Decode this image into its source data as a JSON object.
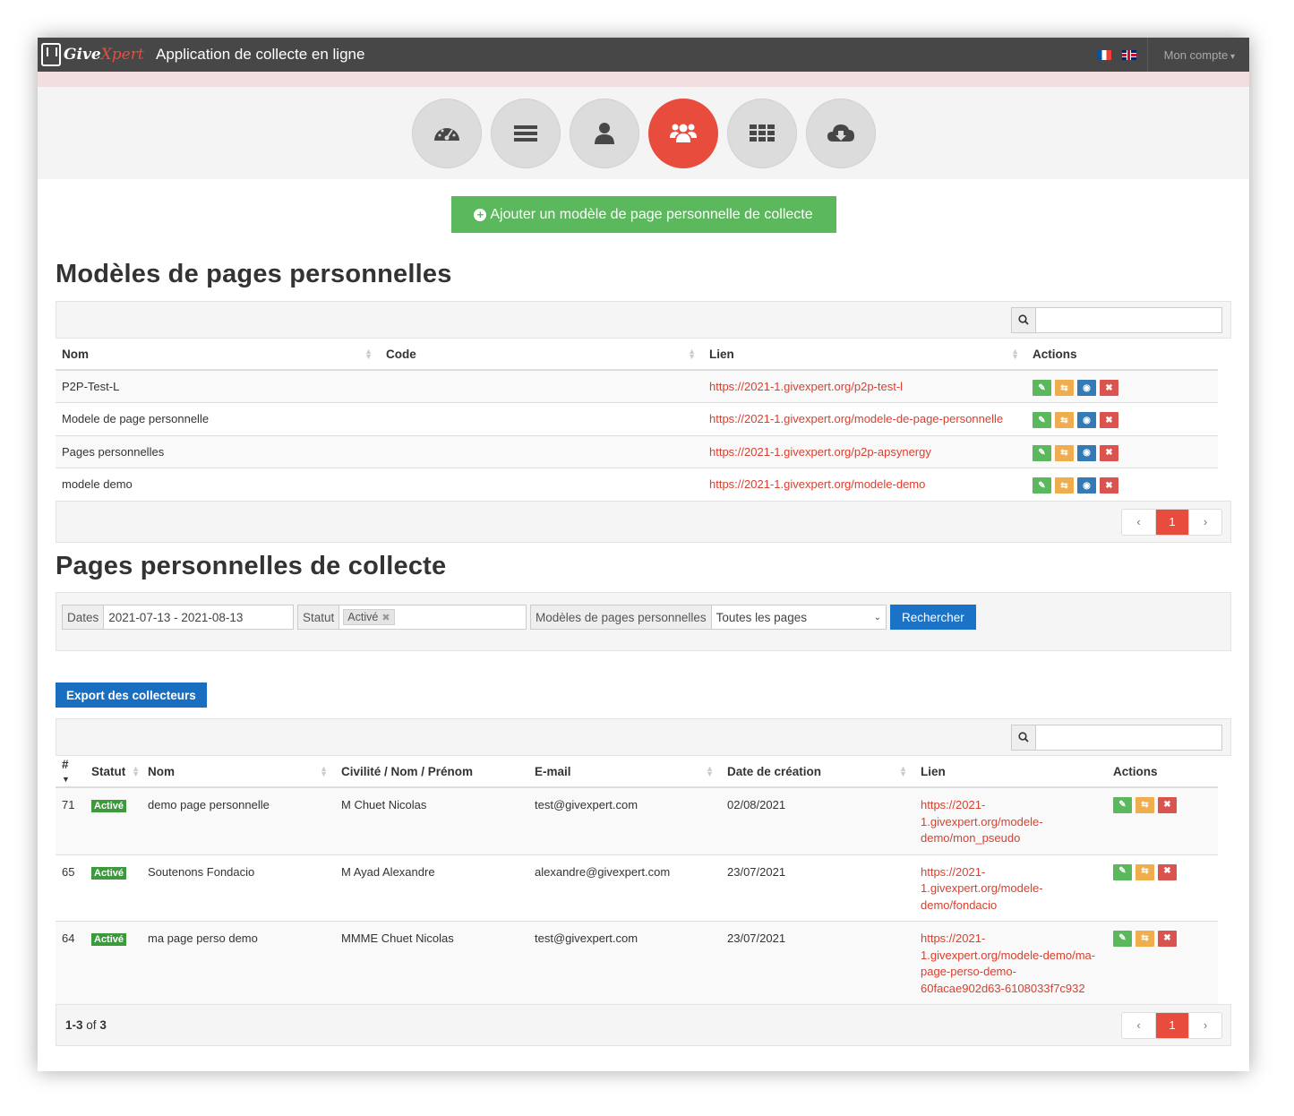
{
  "header": {
    "logo_give": "Give",
    "logo_xpert": "Xpert",
    "title": "Application de collecte en ligne",
    "account": "Mon compte"
  },
  "nav_icons": [
    "dashboard-icon",
    "list-icon",
    "user-icon",
    "group-icon",
    "grid-icon",
    "cloud-download-icon"
  ],
  "add_button": "Ajouter un modèle de page personnelle de collecte",
  "models": {
    "title": "Modèles de pages personnelles",
    "columns": [
      "Nom",
      "Code",
      "Lien",
      "Actions"
    ],
    "rows": [
      {
        "nom": "P2P-Test-L",
        "code": "",
        "lien": "https://2021-1.givexpert.org/p2p-test-l"
      },
      {
        "nom": "Modele de page personnelle",
        "code": "",
        "lien": "https://2021-1.givexpert.org/modele-de-page-personnelle"
      },
      {
        "nom": "Pages personnelles",
        "code": "",
        "lien": "https://2021-1.givexpert.org/p2p-apsynergy"
      },
      {
        "nom": "modele demo",
        "code": "",
        "lien": "https://2021-1.givexpert.org/modele-demo"
      }
    ],
    "pager": {
      "prev": "‹",
      "page": "1",
      "next": "›"
    }
  },
  "pages": {
    "title": "Pages personnelles de collecte",
    "filters": {
      "dates_label": "Dates",
      "dates_value": "2021-07-13 - 2021-08-13",
      "statut_label": "Statut",
      "statut_tag": "Activé",
      "modeles_label": "Modèles de pages personnelles",
      "modeles_value": "Toutes les pages",
      "search_button": "Rechercher"
    },
    "export_button": "Export des collecteurs",
    "columns": [
      "#",
      "Statut",
      "Nom",
      "Civilité / Nom / Prénom",
      "E-mail",
      "Date de création",
      "Lien",
      "Actions"
    ],
    "rows": [
      {
        "id": "71",
        "statut": "Activé",
        "nom": "demo page personnelle",
        "civ": "M Chuet Nicolas",
        "email": "test@givexpert.com",
        "date": "02/08/2021",
        "lien": [
          "https://2021-",
          "1.givexpert.org/modele-",
          "demo/mon_pseudo"
        ]
      },
      {
        "id": "65",
        "statut": "Activé",
        "nom": "Soutenons Fondacio",
        "civ": "M Ayad Alexandre",
        "email": "alexandre@givexpert.com",
        "date": "23/07/2021",
        "lien": [
          "https://2021-",
          "1.givexpert.org/modele-",
          "demo/fondacio"
        ]
      },
      {
        "id": "64",
        "statut": "Activé",
        "nom": "ma page perso demo",
        "civ": "MMME Chuet Nicolas",
        "email": "test@givexpert.com",
        "date": "23/07/2021",
        "lien": [
          "https://2021-",
          "1.givexpert.org/modele-demo/ma-",
          "page-perso-demo-",
          "60facae902d63-6108033f7c932"
        ]
      }
    ],
    "footer_range": "1-3",
    "footer_of": "of",
    "footer_total": "3",
    "pager": {
      "prev": "‹",
      "page": "1",
      "next": "›"
    }
  }
}
